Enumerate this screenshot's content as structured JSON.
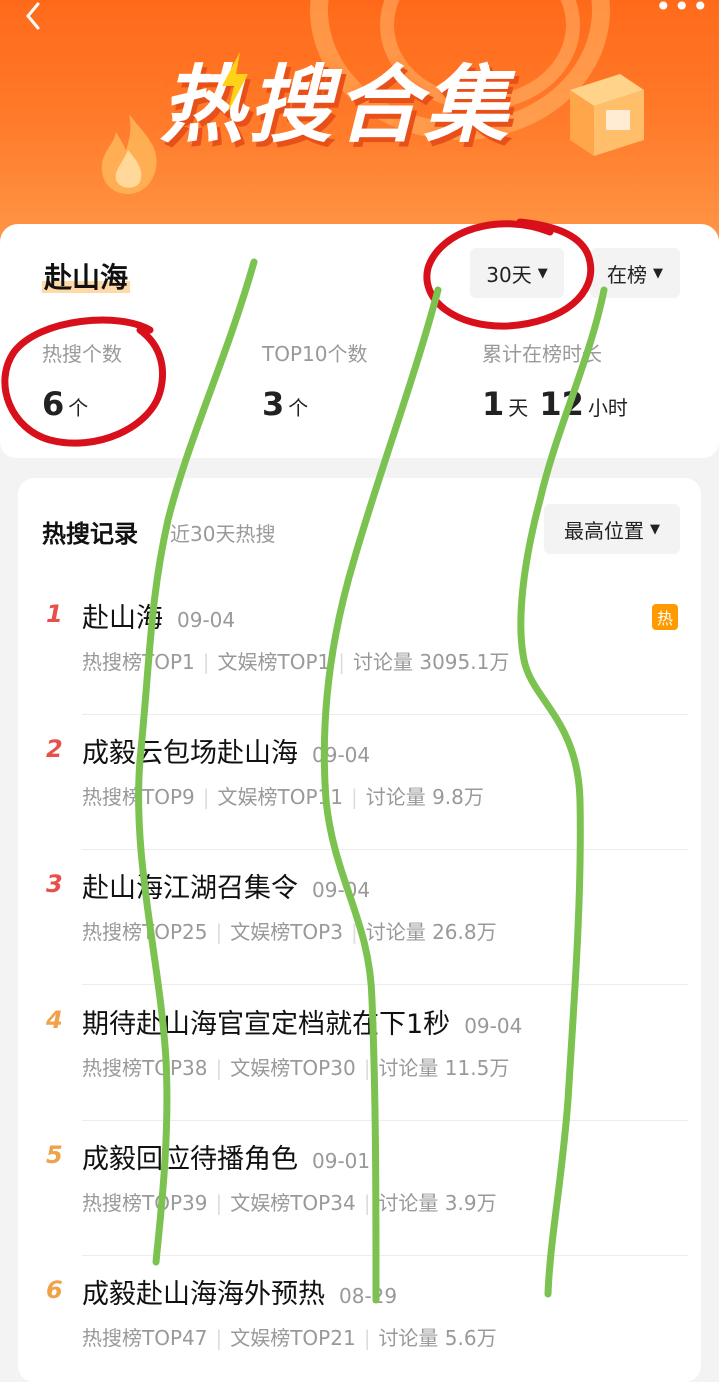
{
  "banner": {
    "title": "热搜合集",
    "more": "•••"
  },
  "summary": {
    "topic": "赴山海",
    "period_filter": "30天",
    "board_filter": "在榜",
    "stats": [
      {
        "label": "热搜个数",
        "value": "6",
        "unit": "个"
      },
      {
        "label": "TOP10个数",
        "value": "3",
        "unit": "个"
      },
      {
        "label": "累计在榜时长",
        "value": "1",
        "unit": "天",
        "value2": "12",
        "unit2": "小时"
      }
    ]
  },
  "records": {
    "title": "热搜记录",
    "subtitle": "近30天热搜",
    "sort_label": "最高位置",
    "items": [
      {
        "rank": "1",
        "name": "赴山海",
        "date": "09-04",
        "hot": "热",
        "meta": [
          "热搜榜TOP1",
          "文娱榜TOP1",
          "讨论量 3095.1万"
        ]
      },
      {
        "rank": "2",
        "name": "成毅云包场赴山海",
        "date": "09-04",
        "meta": [
          "热搜榜TOP9",
          "文娱榜TOP11",
          "讨论量 9.8万"
        ]
      },
      {
        "rank": "3",
        "name": "赴山海江湖召集令",
        "date": "09-04",
        "meta": [
          "热搜榜TOP25",
          "文娱榜TOP3",
          "讨论量 26.8万"
        ]
      },
      {
        "rank": "4",
        "name": "期待赴山海官宣定档就在下1秒",
        "date": "09-04",
        "meta": [
          "热搜榜TOP38",
          "文娱榜TOP30",
          "讨论量 11.5万"
        ]
      },
      {
        "rank": "5",
        "name": "成毅回应待播角色",
        "date": "09-01",
        "meta": [
          "热搜榜TOP39",
          "文娱榜TOP34",
          "讨论量 3.9万"
        ]
      },
      {
        "rank": "6",
        "name": "成毅赴山海海外预热",
        "date": "08-29",
        "meta": [
          "热搜榜TOP47",
          "文娱榜TOP21",
          "讨论量 5.6万"
        ]
      }
    ]
  },
  "colors": {
    "banner": "#ff6a1a",
    "rank_top": "#e8504a",
    "rank_other": "#f0a24a",
    "annotation_red": "#d8101c",
    "annotation_green": "#7cc250"
  }
}
